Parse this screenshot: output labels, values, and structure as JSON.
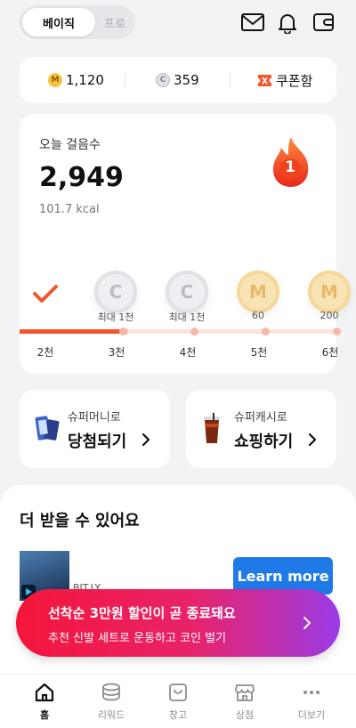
{
  "topbar": {
    "mode_active": "베이직",
    "mode_inactive": "프로",
    "icons": [
      "mail-icon",
      "bell-icon",
      "wallet-icon"
    ]
  },
  "balance": {
    "m_coin": "1,120",
    "c_coin": "359",
    "coupon_label": "쿠폰함",
    "m_symbol": "M",
    "c_symbol": "C"
  },
  "steps": {
    "title": "오늘 걸음수",
    "count": "2,949",
    "kcal": "101.7 kcal",
    "streak": "1",
    "progress_fraction": 0.34,
    "milestones": [
      {
        "symbol": "C",
        "label": "최대 1천",
        "type": "c"
      },
      {
        "symbol": "C",
        "label": "최대 1천",
        "type": "c"
      },
      {
        "symbol": "M",
        "label": "60",
        "type": "m"
      },
      {
        "symbol": "M",
        "label": "200",
        "type": "m"
      }
    ],
    "ticks": [
      "2천",
      "3천",
      "4천",
      "5천",
      "6천"
    ]
  },
  "promos": [
    {
      "sub": "슈퍼머니로",
      "main": "당첨되기"
    },
    {
      "sub": "슈퍼캐시로",
      "main": "쇼핑하기"
    }
  ],
  "more": {
    "title": "더 받을 수 있어요",
    "ad_source": "BIT.LY",
    "ad_cta": "Learn more"
  },
  "banner": {
    "title": "선착순 3만원 할인이 곧 종료돼요",
    "subtitle": "추천 신발 세트로 운동하고 코인 벌기"
  },
  "tabs": [
    {
      "label": "홈",
      "icon": "home-icon"
    },
    {
      "label": "리워드",
      "icon": "coins-icon"
    },
    {
      "label": "창고",
      "icon": "box-icon"
    },
    {
      "label": "상점",
      "icon": "store-icon"
    },
    {
      "label": "더보기",
      "icon": "more-icon"
    }
  ],
  "colors": {
    "accent": "#f2552c",
    "banner_start": "#f4163a",
    "banner_end": "#9a3be6",
    "cta_blue": "#1f7ae8"
  }
}
